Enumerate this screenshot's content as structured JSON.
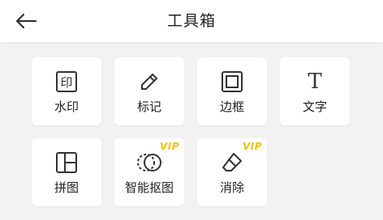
{
  "header": {
    "title": "工具箱",
    "back_icon": "back-arrow-icon"
  },
  "tools": [
    {
      "label": "水印",
      "icon": "watermark-icon",
      "vip": false
    },
    {
      "label": "标记",
      "icon": "pen-icon",
      "vip": false
    },
    {
      "label": "边框",
      "icon": "frame-icon",
      "vip": false
    },
    {
      "label": "文字",
      "icon": "text-icon",
      "glyph": "T",
      "vip": false
    },
    {
      "label": "拼图",
      "icon": "collage-icon",
      "vip": false
    },
    {
      "label": "智能抠图",
      "icon": "cutout-icon",
      "vip": true,
      "badge": "VIP"
    },
    {
      "label": "消除",
      "icon": "eraser-icon",
      "vip": true,
      "badge": "VIP"
    }
  ],
  "colors": {
    "background": "#f2f2f2",
    "tile": "#ffffff",
    "icon": "#333333",
    "vip_badge": "#f0c200"
  }
}
